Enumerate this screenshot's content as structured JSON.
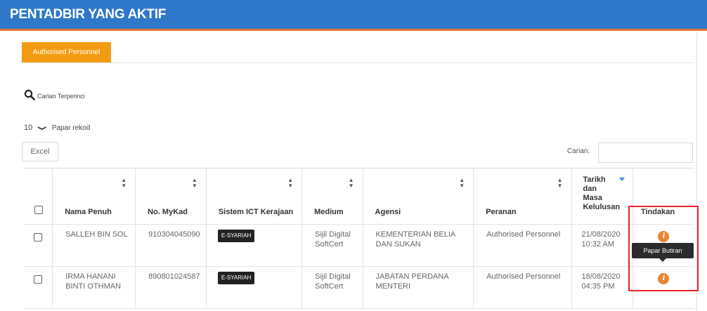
{
  "header": {
    "title": "PENTADBIR YANG AKTIF",
    "accent_color": "#2f78c9",
    "underline_color": "#e5732c"
  },
  "tabs": [
    {
      "label": "Authorised Personnel",
      "active": true,
      "color": "#f39c12"
    }
  ],
  "advanced_search": {
    "label": "Carian Terperinci",
    "icon": "search-icon"
  },
  "page_length": {
    "value": "10",
    "label": "Papar rekod"
  },
  "excel_button": {
    "label": "Excel"
  },
  "search": {
    "label": "Carian:",
    "value": ""
  },
  "table": {
    "columns": [
      "",
      "Nama Penuh",
      "No. MyKad",
      "Sistem ICT Kerajaan",
      "Medium",
      "Agensi",
      "Peranan",
      "Tarikh dan Masa Kelulusan",
      "Tindakan"
    ],
    "tarikh_header_lines": [
      "Tarikh",
      "dan",
      "Masa",
      "Kelulusan"
    ],
    "rows": [
      {
        "nama": "SALLEH BIN SOL",
        "mykad": "910304045090",
        "sistem": "E-SYARIAH",
        "medium": [
          "Sijil Digital",
          "SoftCert"
        ],
        "agensi": [
          "KEMENTERIAN BELIA",
          "DAN SUKAN"
        ],
        "peranan": "Authorised Personnel",
        "tarikh": [
          "21/08/2020",
          "10:32 AM"
        ]
      },
      {
        "nama": [
          "IRMA HANANI",
          "BINTI OTHMAN"
        ],
        "mykad": "890801024587",
        "sistem": "E-SYARIAH",
        "medium": [
          "Sijil Digital",
          "SoftCert"
        ],
        "agensi": [
          "JABATAN PERDANA",
          "MENTERI"
        ],
        "peranan": "Authorised Personnel",
        "tarikh": [
          "18/08/2020",
          "04:35 PM"
        ]
      }
    ]
  },
  "tooltip": {
    "text": "Papar Butiran"
  },
  "info_button_color": "#e88432",
  "highlight_color": "#e8272f"
}
